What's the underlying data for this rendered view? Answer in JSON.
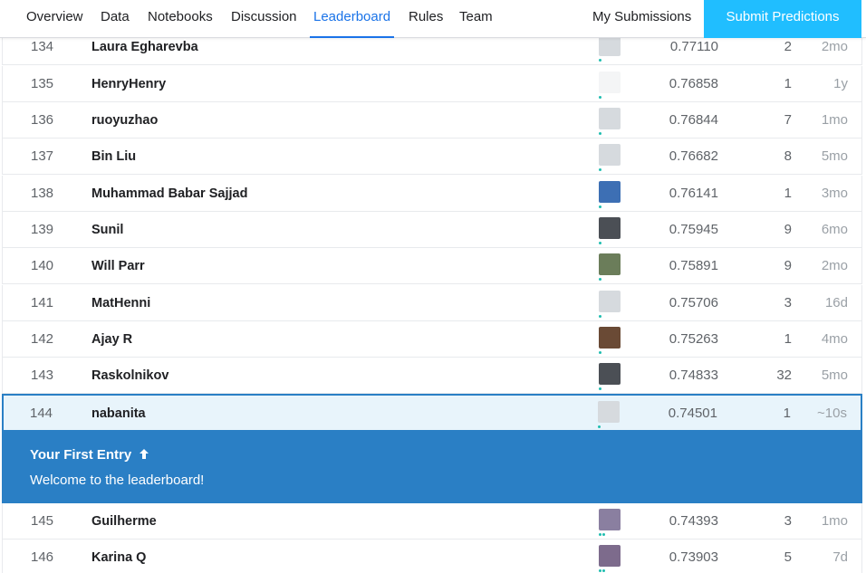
{
  "nav": {
    "tabs": [
      {
        "label": "Overview"
      },
      {
        "label": "Data"
      },
      {
        "label": "Notebooks"
      },
      {
        "label": "Discussion"
      },
      {
        "label": "Leaderboard"
      },
      {
        "label": "Rules"
      },
      {
        "label": "Team"
      }
    ],
    "active_tab": "Leaderboard",
    "my_submissions": "My Submissions",
    "submit_button": "Submit Predictions"
  },
  "rows": [
    {
      "rank": "134",
      "name": "Laura Egharevba",
      "score": "0.77110",
      "entries": "2",
      "last": "2mo"
    },
    {
      "rank": "135",
      "name": "HenryHenry",
      "score": "0.76858",
      "entries": "1",
      "last": "1y"
    },
    {
      "rank": "136",
      "name": "ruoyuzhao",
      "score": "0.76844",
      "entries": "7",
      "last": "1mo"
    },
    {
      "rank": "137",
      "name": "Bin Liu",
      "score": "0.76682",
      "entries": "8",
      "last": "5mo"
    },
    {
      "rank": "138",
      "name": "Muhammad Babar Sajjad",
      "score": "0.76141",
      "entries": "1",
      "last": "3mo"
    },
    {
      "rank": "139",
      "name": "Sunil",
      "score": "0.75945",
      "entries": "9",
      "last": "6mo"
    },
    {
      "rank": "140",
      "name": "Will Parr",
      "score": "0.75891",
      "entries": "9",
      "last": "2mo"
    },
    {
      "rank": "141",
      "name": "MatHenni",
      "score": "0.75706",
      "entries": "3",
      "last": "16d"
    },
    {
      "rank": "142",
      "name": "Ajay R",
      "score": "0.75263",
      "entries": "1",
      "last": "4mo"
    },
    {
      "rank": "143",
      "name": "Raskolnikov",
      "score": "0.74833",
      "entries": "32",
      "last": "5mo"
    },
    {
      "rank": "144",
      "name": "nabanita",
      "score": "0.74501",
      "entries": "1",
      "last": "~10s"
    },
    {
      "rank": "145",
      "name": "Guilherme",
      "score": "0.74393",
      "entries": "3",
      "last": "1mo"
    },
    {
      "rank": "146",
      "name": "Karina Q",
      "score": "0.73903",
      "entries": "5",
      "last": "7d"
    }
  ],
  "banner": {
    "title": "Your First Entry",
    "arrow_icon": "arrow-up-icon",
    "message": "Welcome to the leaderboard!"
  },
  "colors": {
    "accent": "#1a73e8",
    "submit_bg": "#20beff",
    "banner_bg": "#2a7fc5",
    "highlight_row_bg": "#e8f4fb",
    "tier_dot": "#20beb0"
  }
}
